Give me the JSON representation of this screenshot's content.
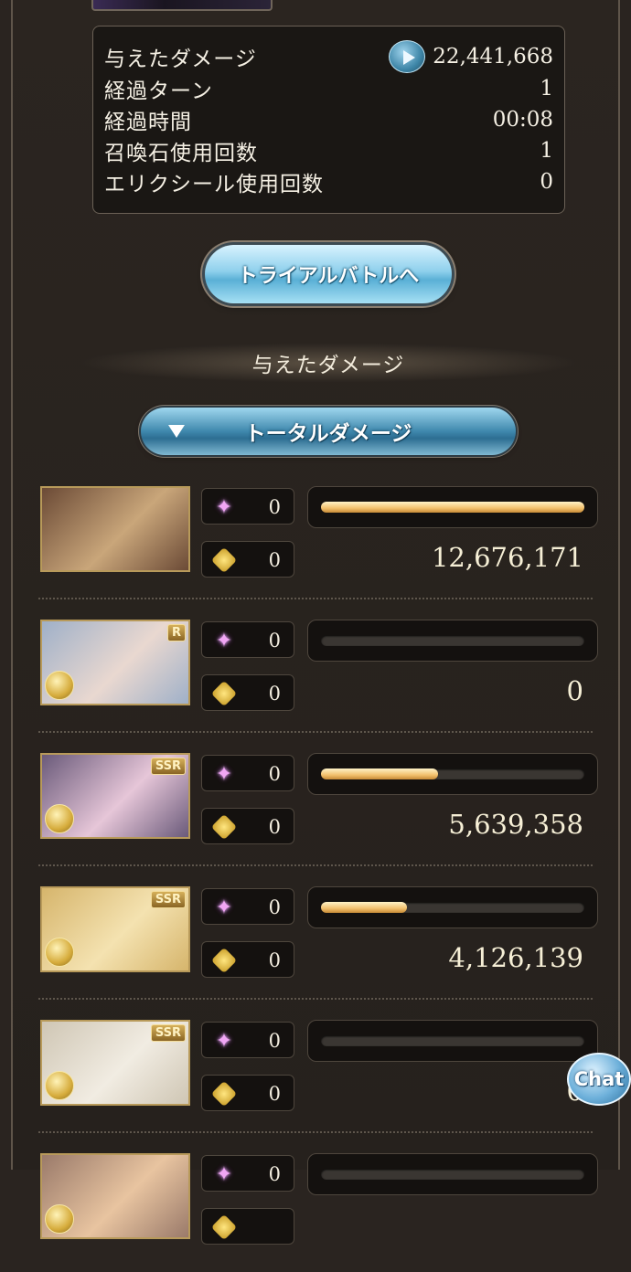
{
  "summary": {
    "rows": [
      {
        "label": "与えたダメージ",
        "value": "22,441,668",
        "has_icon": true
      },
      {
        "label": "経過ターン",
        "value": "1"
      },
      {
        "label": "経過時間",
        "value": "00:08"
      },
      {
        "label": "召喚石使用回数",
        "value": "1"
      },
      {
        "label": "エリクシール使用回数",
        "value": "0"
      }
    ]
  },
  "trial_button": {
    "label": "トライアルバトルへ"
  },
  "section": {
    "title": "与えたダメージ"
  },
  "filter": {
    "selected": "トータルダメージ"
  },
  "members": [
    {
      "ability_count": "0",
      "ca_count": "0",
      "damage": "12,676,171",
      "bar_fraction": 1.0,
      "rarity": "",
      "colors": [
        "#6b4a36",
        "#c9a67a"
      ]
    },
    {
      "ability_count": "0",
      "ca_count": "0",
      "damage": "0",
      "bar_fraction": 0.0,
      "rarity": "R",
      "colors": [
        "#9fb0c8",
        "#e9d8d0"
      ]
    },
    {
      "ability_count": "0",
      "ca_count": "0",
      "damage": "5,639,358",
      "bar_fraction": 0.445,
      "rarity": "SSR",
      "colors": [
        "#6a5a7a",
        "#e6c6d8"
      ]
    },
    {
      "ability_count": "0",
      "ca_count": "0",
      "damage": "4,126,139",
      "bar_fraction": 0.325,
      "rarity": "SSR",
      "colors": [
        "#d6b56c",
        "#f4e2b0"
      ]
    },
    {
      "ability_count": "0",
      "ca_count": "0",
      "damage": "0",
      "bar_fraction": 0.0,
      "rarity": "SSR",
      "colors": [
        "#cfc6b4",
        "#f1ece2"
      ]
    },
    {
      "ability_count": "0",
      "ca_count": "",
      "damage": "",
      "bar_fraction": 0.0,
      "rarity": "",
      "colors": [
        "#9a7a6a",
        "#e8c4a0"
      ]
    }
  ],
  "chat": {
    "label": "Chat"
  },
  "icons": {
    "damage_play": "play-circle-icon",
    "ability": "ability-star-icon",
    "charge_attack": "charge-attack-icon"
  }
}
